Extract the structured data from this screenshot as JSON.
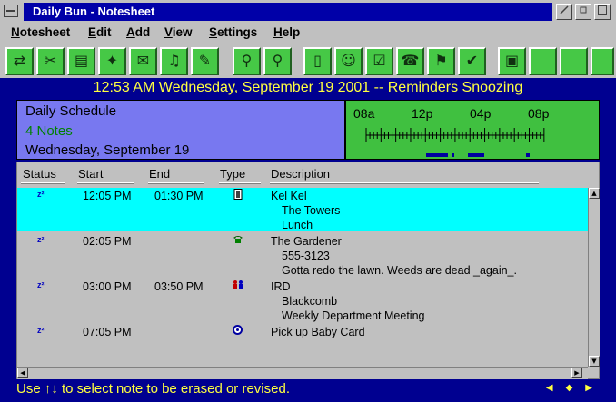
{
  "window": {
    "title": "Daily Bun - Notesheet"
  },
  "menu": [
    {
      "label": "Notesheet",
      "underline": "N"
    },
    {
      "label": "Edit",
      "underline": "E"
    },
    {
      "label": "Add",
      "underline": "A"
    },
    {
      "label": "View",
      "underline": "V"
    },
    {
      "label": "Settings",
      "underline": "S"
    },
    {
      "label": "Help",
      "underline": "H"
    }
  ],
  "toolbar_icons": [
    "refresh-icon",
    "cut-icon",
    "notes-icon",
    "wand-icon",
    "mail-icon",
    "piano-icon",
    "draw-icon",
    "zoom-out-icon",
    "zoom-in-icon",
    "door-icon",
    "people-icon",
    "checklist-icon",
    "phone-icon",
    "runner-icon",
    "check-target-icon",
    "printer-icon",
    "blank",
    "blank",
    "blank"
  ],
  "banner": "12:53 AM Wednesday, September 19 2001 -- Reminders Snoozing",
  "schedule": {
    "title": "Daily Schedule",
    "count": "4 Notes",
    "date": "Wednesday, September 19"
  },
  "timeline": {
    "labels": [
      "08a",
      "12p",
      "04p",
      "08p"
    ],
    "colors": {
      "bg": "#40c040",
      "bar": "#0000a0"
    }
  },
  "columns": {
    "status": "Status",
    "start": "Start",
    "end": "End",
    "type": "Type",
    "description": "Description"
  },
  "notes": [
    {
      "status": "z²",
      "start": "12:05 PM",
      "end": "01:30 PM",
      "type": "door-icon",
      "lines": [
        "Kel Kel",
        "The Towers",
        "Lunch"
      ],
      "selected": true
    },
    {
      "status": "z²",
      "start": "02:05 PM",
      "end": "",
      "type": "phone-icon",
      "lines": [
        "The Gardener",
        "555-3123",
        "Gotta redo the lawn. Weeds are dead _again_."
      ],
      "selected": false
    },
    {
      "status": "z²",
      "start": "03:00 PM",
      "end": "03:50 PM",
      "type": "people-icon",
      "lines": [
        "IRD",
        "Blackcomb",
        "Weekly Department Meeting"
      ],
      "selected": false
    },
    {
      "status": "z²",
      "start": "07:05 PM",
      "end": "",
      "type": "target-icon",
      "lines": [
        "Pick up Baby Card"
      ],
      "selected": false
    }
  ],
  "statusbar": "Use ↑↓ to select note to be erased or revised.",
  "colors": {
    "main": "#000090",
    "banner": "#ffff40",
    "selection": "#00ffff",
    "toolbar_button": "#46c846",
    "schedule_panel": "#7878f0"
  }
}
